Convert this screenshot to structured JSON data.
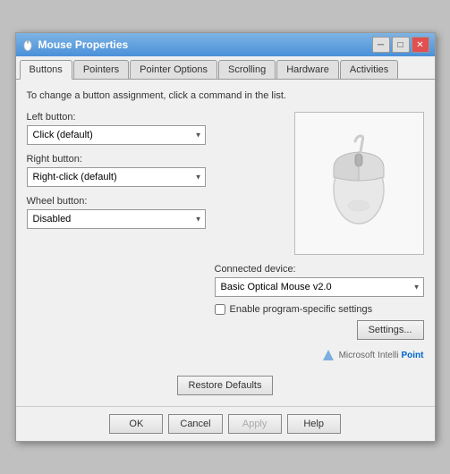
{
  "window": {
    "title": "Mouse Properties",
    "close_btn": "✕",
    "minimize_btn": "─",
    "maximize_btn": "□"
  },
  "tabs": [
    {
      "label": "Buttons",
      "active": true
    },
    {
      "label": "Pointers",
      "active": false
    },
    {
      "label": "Pointer Options",
      "active": false
    },
    {
      "label": "Scrolling",
      "active": false
    },
    {
      "label": "Hardware",
      "active": false
    },
    {
      "label": "Activities",
      "active": false
    }
  ],
  "content": {
    "instruction": "To change a button assignment, click a command in the list.",
    "left_button_label": "Left button:",
    "left_button_value": "Click (default)",
    "right_button_label": "Right button:",
    "right_button_value": "Right-click (default)",
    "wheel_button_label": "Wheel button:",
    "wheel_button_value": "Disabled"
  },
  "right_panel": {
    "connected_label": "Connected device:",
    "connected_value": "Basic Optical Mouse v2.0",
    "checkbox_label": "Enable program-specific settings",
    "settings_btn": "Settings...",
    "brand": "Microsoft",
    "product": "IntelliPoint"
  },
  "footer": {
    "restore_btn": "Restore Defaults",
    "ok_btn": "OK",
    "cancel_btn": "Cancel",
    "apply_btn": "Apply",
    "help_btn": "Help"
  }
}
